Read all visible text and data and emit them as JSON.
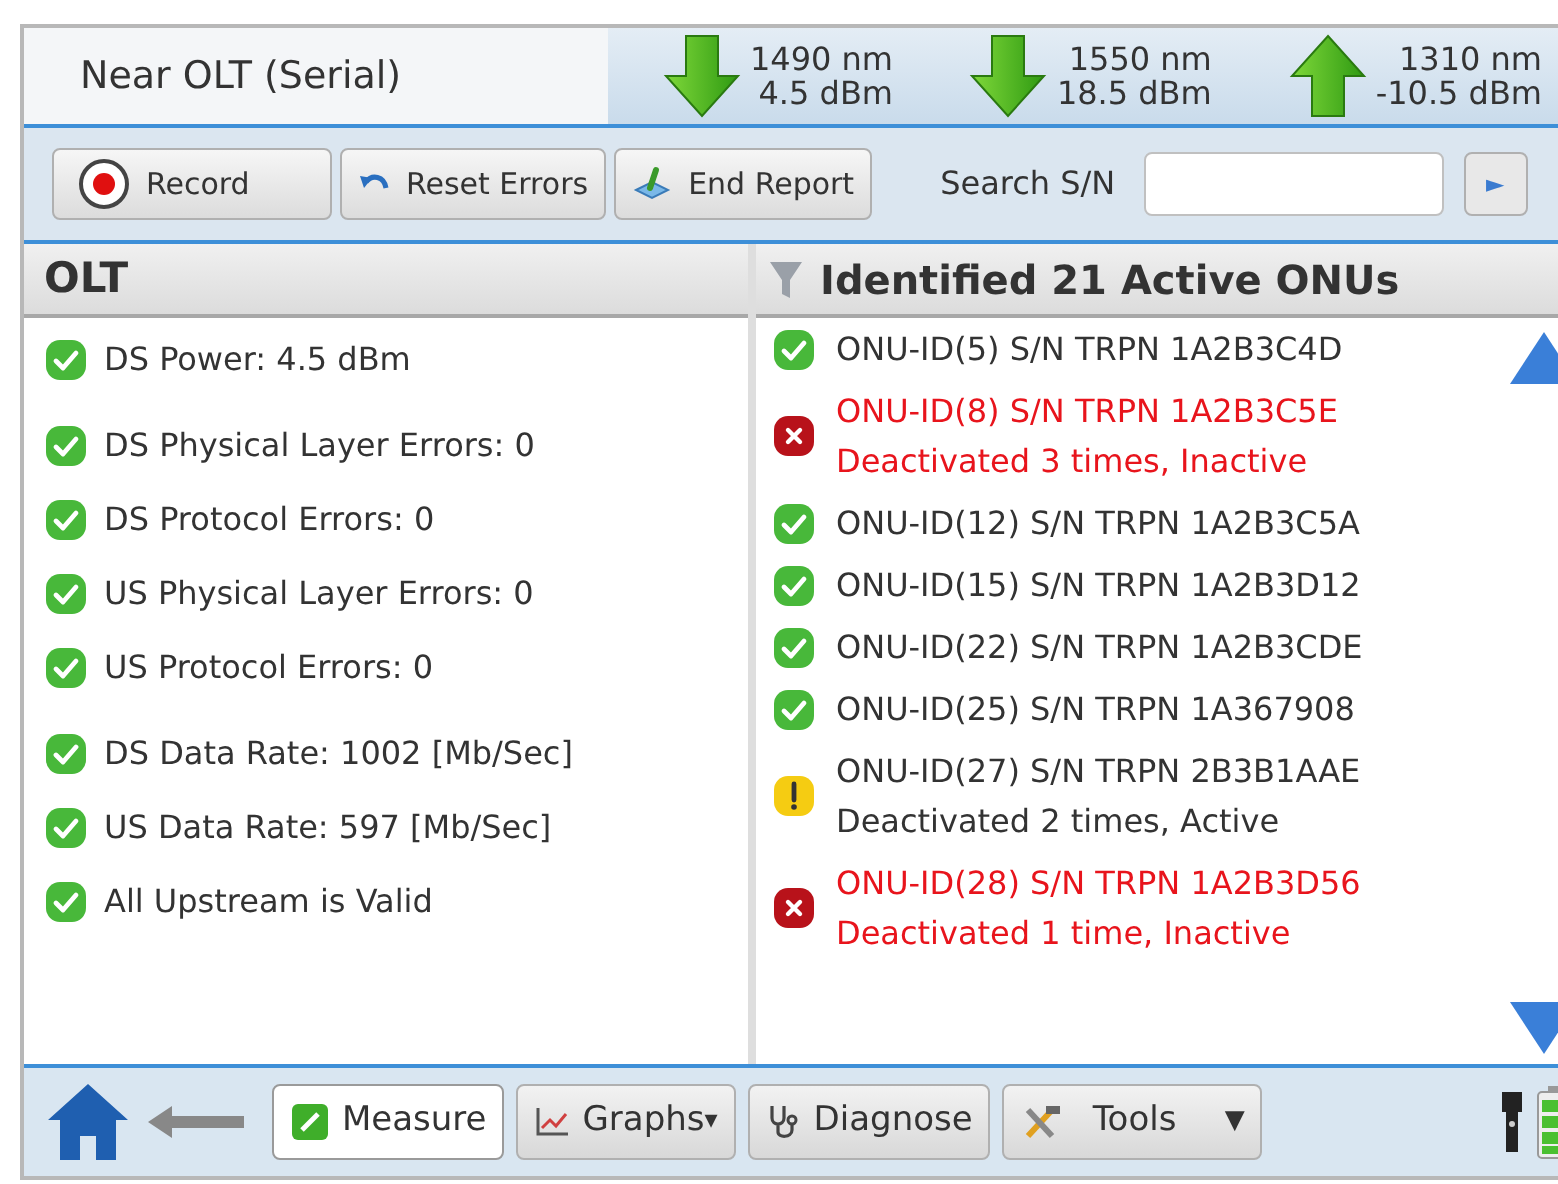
{
  "header": {
    "title": "Near OLT (Serial)",
    "wavelengths": [
      {
        "kind": "down",
        "wavelength": "1490 nm",
        "power": "4.5 dBm"
      },
      {
        "kind": "down",
        "wavelength": "1550 nm",
        "power": "18.5 dBm"
      },
      {
        "kind": "up",
        "wavelength": "1310 nm",
        "power": "-10.5 dBm"
      }
    ]
  },
  "toolbar": {
    "buttons": [
      {
        "label": "Record"
      },
      {
        "label": "Reset Errors"
      },
      {
        "label": "End Report"
      }
    ],
    "search": {
      "label": "Search S/N",
      "go": "►"
    }
  },
  "olt": {
    "title": "OLT",
    "groups": [
      [
        {
          "text": "DS Power: 4.5 dBm",
          "kind": "ok"
        }
      ],
      [
        {
          "text": "DS Physical Layer Errors: 0",
          "kind": "ok"
        },
        {
          "text": "DS Protocol Errors: 0",
          "kind": "ok"
        },
        {
          "text": "US Physical Layer Errors: 0",
          "kind": "ok"
        },
        {
          "text": "US Protocol Errors: 0",
          "kind": "ok"
        }
      ],
      [
        {
          "text": "DS Data Rate: 1002 [Mb/Sec]",
          "kind": "ok"
        },
        {
          "text": "US Data Rate: 597 [Mb/Sec]",
          "kind": "ok"
        },
        {
          "text": "All Upstream is Valid",
          "kind": "ok"
        }
      ]
    ]
  },
  "onus": {
    "title": "Identified 21 Active ONUs",
    "items": [
      {
        "kind": "ok",
        "lines": [
          "ONU-ID(5) S/N TRPN 1A2B3C4D"
        ]
      },
      {
        "kind": "error",
        "lines": [
          "ONU-ID(8) S/N TRPN 1A2B3C5E",
          "Deactivated 3 times, Inactive"
        ]
      },
      {
        "kind": "ok",
        "lines": [
          "ONU-ID(12) S/N TRPN 1A2B3C5A"
        ]
      },
      {
        "kind": "ok",
        "lines": [
          "ONU-ID(15) S/N TRPN 1A2B3D12"
        ]
      },
      {
        "kind": "ok",
        "lines": [
          "ONU-ID(22) S/N TRPN 1A2B3CDE"
        ]
      },
      {
        "kind": "ok",
        "lines": [
          "ONU-ID(25) S/N TRPN 1A367908"
        ]
      },
      {
        "kind": "warning",
        "lines": [
          "ONU-ID(27) S/N TRPN 2B3B1AAE",
          "Deactivated 2 times, Active"
        ]
      },
      {
        "kind": "error",
        "lines": [
          "ONU-ID(28) S/N TRPN 1A2B3D56",
          "Deactivated 1 time, Inactive"
        ]
      }
    ]
  },
  "nav": {
    "buttons": [
      {
        "label": "Measure",
        "selected": true
      },
      {
        "label": "Graphs",
        "selected": false,
        "caret": "▾",
        "kind": "inline"
      },
      {
        "label": "Diagnose",
        "selected": false
      },
      {
        "label": "Tools",
        "selected": false,
        "caret": "▼",
        "kind": "split"
      }
    ]
  }
}
